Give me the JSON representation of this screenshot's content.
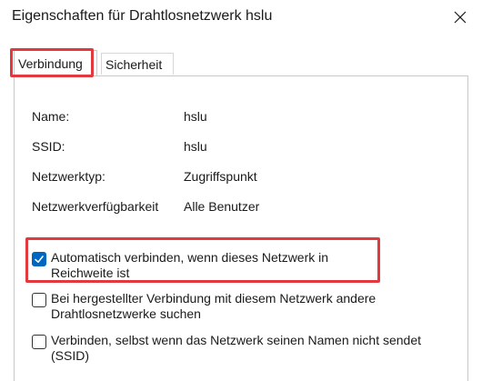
{
  "window": {
    "title": "Eigenschaften für Drahtlosnetzwerk hslu",
    "close_icon": "close-icon"
  },
  "tabs": [
    {
      "label": "Verbindung",
      "active": true
    },
    {
      "label": "Sicherheit",
      "active": false
    }
  ],
  "properties": {
    "name_label": "Name:",
    "name_value": "hslu",
    "ssid_label": "SSID:",
    "ssid_value": "hslu",
    "type_label": "Netzwerktyp:",
    "type_value": "Zugriffspunkt",
    "availability_label": "Netzwerkverfügbarkeit",
    "availability_value": "Alle Benutzer"
  },
  "options": [
    {
      "label": "Automatisch verbinden, wenn dieses Netzwerk in Reichweite ist",
      "checked": true
    },
    {
      "label": "Bei hergestellter Verbindung mit diesem Netzwerk andere Drahtlosnetzwerke suchen",
      "checked": false
    },
    {
      "label": "Verbinden, selbst wenn das Netzwerk seinen Namen nicht sendet (SSID)",
      "checked": false
    }
  ],
  "colors": {
    "highlight": "#e2393f",
    "checkbox_accent": "#0067c0"
  }
}
